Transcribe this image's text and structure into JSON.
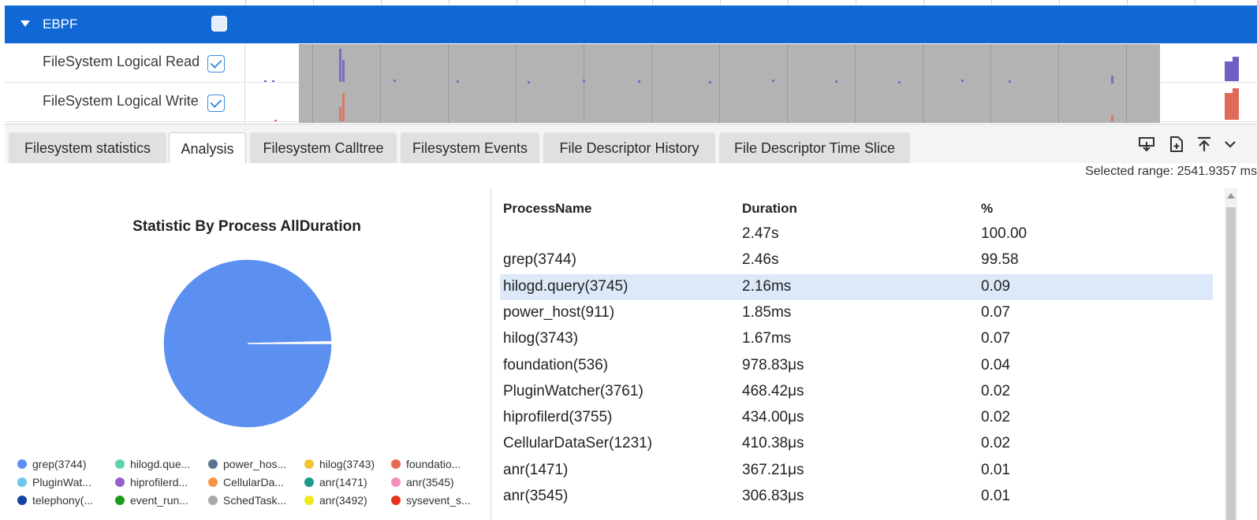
{
  "timeline": {
    "group_label": "EBPF",
    "tracks": [
      {
        "name": "FileSystem Logical Read",
        "color": "#6f5fc4"
      },
      {
        "name": "FileSystem Logical Write",
        "color": "#e06a5a"
      }
    ]
  },
  "tabs": [
    {
      "label": "Filesystem statistics",
      "active": false
    },
    {
      "label": "Analysis",
      "active": true
    },
    {
      "label": "Filesystem Calltree",
      "active": false
    },
    {
      "label": "Filesystem Events",
      "active": false
    },
    {
      "label": "File Descriptor History",
      "active": false
    },
    {
      "label": "File Descriptor Time Slice",
      "active": false
    }
  ],
  "toolbar": {
    "icons": [
      "download-icon",
      "new-file-icon",
      "expand-up-icon",
      "chevron-down-icon"
    ]
  },
  "selected_range": "Selected range: 2541.9357 ms",
  "chart": {
    "title": "Statistic By Process AllDuration",
    "legend": [
      {
        "label": "grep(3744)",
        "color": "#5b8ff0"
      },
      {
        "label": "hilogd.que...",
        "color": "#5cd6a8"
      },
      {
        "label": "power_hos...",
        "color": "#5c7396"
      },
      {
        "label": "hilog(3743)",
        "color": "#f2c230"
      },
      {
        "label": "foundatio...",
        "color": "#e86a50"
      },
      {
        "label": "PluginWat...",
        "color": "#6ec6ea"
      },
      {
        "label": "hiprofilerd...",
        "color": "#9560c8"
      },
      {
        "label": "CellularDa...",
        "color": "#f4954a"
      },
      {
        "label": "anr(1471)",
        "color": "#1d9a8e"
      },
      {
        "label": "anr(3545)",
        "color": "#f28fb8"
      },
      {
        "label": "telephony(...",
        "color": "#1342a5"
      },
      {
        "label": "event_run...",
        "color": "#1c9a1c"
      },
      {
        "label": "SchedTask...",
        "color": "#a8a8a8"
      },
      {
        "label": "anr(3492)",
        "color": "#f0e81a"
      },
      {
        "label": "sysevent_s...",
        "color": "#e8341a"
      }
    ]
  },
  "chart_data": {
    "type": "pie",
    "title": "Statistic By Process AllDuration",
    "slices": [
      {
        "label": "grep(3744)",
        "value": 99.58,
        "color": "#5b8ff0"
      },
      {
        "label": "hilogd.query(3745)",
        "value": 0.09,
        "color": "#5cd6a8"
      },
      {
        "label": "power_host(911)",
        "value": 0.07,
        "color": "#5c7396"
      },
      {
        "label": "hilog(3743)",
        "value": 0.07,
        "color": "#f2c230"
      },
      {
        "label": "foundation(536)",
        "value": 0.04,
        "color": "#e86a50"
      },
      {
        "label": "PluginWatcher(3761)",
        "value": 0.02,
        "color": "#6ec6ea"
      },
      {
        "label": "hiprofilerd(3755)",
        "value": 0.02,
        "color": "#9560c8"
      },
      {
        "label": "CellularDataSer(1231)",
        "value": 0.02,
        "color": "#f4954a"
      },
      {
        "label": "anr(1471)",
        "value": 0.01,
        "color": "#1d9a8e"
      },
      {
        "label": "anr(3545)",
        "value": 0.01,
        "color": "#f28fb8"
      }
    ]
  },
  "table": {
    "headers": [
      "ProcessName",
      "Duration",
      "%"
    ],
    "rows": [
      {
        "name": "",
        "duration": "2.47s",
        "pct": "100.00"
      },
      {
        "name": "grep(3744)",
        "duration": "2.46s",
        "pct": "99.58"
      },
      {
        "name": "hilogd.query(3745)",
        "duration": "2.16ms",
        "pct": "0.09"
      },
      {
        "name": "power_host(911)",
        "duration": "1.85ms",
        "pct": "0.07"
      },
      {
        "name": "hilog(3743)",
        "duration": "1.67ms",
        "pct": "0.07"
      },
      {
        "name": "foundation(536)",
        "duration": "978.83μs",
        "pct": "0.04"
      },
      {
        "name": "PluginWatcher(3761)",
        "duration": "468.42μs",
        "pct": "0.02"
      },
      {
        "name": "hiprofilerd(3755)",
        "duration": "434.00μs",
        "pct": "0.02"
      },
      {
        "name": "CellularDataSer(1231)",
        "duration": "410.38μs",
        "pct": "0.02"
      },
      {
        "name": "anr(1471)",
        "duration": "367.21μs",
        "pct": "0.01"
      },
      {
        "name": "anr(3545)",
        "duration": "306.83μs",
        "pct": "0.01"
      }
    ],
    "selected_row": 2
  }
}
